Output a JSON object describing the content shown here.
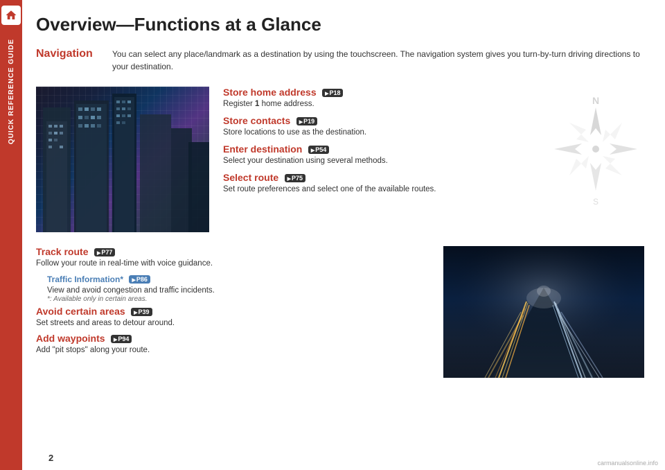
{
  "sidebar": {
    "label": "Quick Reference Guide",
    "home_icon": "home"
  },
  "page": {
    "number": "2",
    "title": "Overview—Functions at a Glance"
  },
  "navigation": {
    "label": "Navigation",
    "description": "You can select any place/landmark as a destination by using the touchscreen. The navigation system gives you turn-by-turn driving directions to your destination."
  },
  "functions_top": [
    {
      "title": "Store home address",
      "badge": "P18",
      "description": "Register 1 home address."
    },
    {
      "title": "Store contacts",
      "badge": "P19",
      "description": "Store locations to use as the destination."
    },
    {
      "title": "Enter destination",
      "badge": "P54",
      "description": "Select your destination using several methods."
    },
    {
      "title": "Select route",
      "badge": "P75",
      "description": "Set route preferences and select one of the available routes."
    }
  ],
  "functions_bottom": [
    {
      "title": "Track route",
      "badge": "P77",
      "description": "Follow your route in real-time with voice guidance."
    },
    {
      "sub_title": "Traffic Information*",
      "sub_badge": "P86",
      "sub_description": "View and avoid congestion and traffic incidents.",
      "sub_note": "*: Available only in certain areas."
    },
    {
      "title": "Avoid certain areas",
      "badge": "P39",
      "description": "Set streets and areas to detour around."
    },
    {
      "title": "Add waypoints",
      "badge": "P94",
      "description": "Add \"pit stops\" along your route."
    }
  ],
  "watermark": "carmanualsonline.info"
}
